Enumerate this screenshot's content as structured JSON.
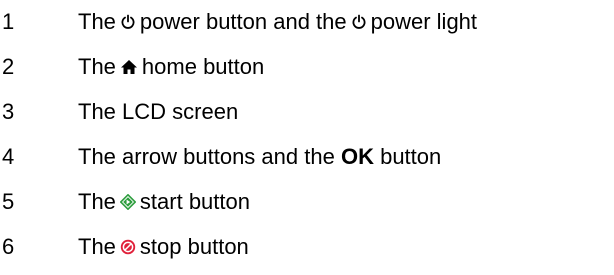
{
  "items": [
    {
      "num": "1",
      "pre": "The",
      "mid": "power button and the",
      "post": "power light",
      "icons": [
        "power-icon",
        "power-icon"
      ]
    },
    {
      "num": "2",
      "pre": "The",
      "post": "home button",
      "icons": [
        "home-icon"
      ]
    },
    {
      "num": "3",
      "text": "The LCD screen"
    },
    {
      "num": "4",
      "pre": "The arrow buttons and the",
      "bold": "OK",
      "post": "button"
    },
    {
      "num": "5",
      "pre": "The",
      "post": "start button",
      "icons": [
        "start-icon"
      ]
    },
    {
      "num": "6",
      "pre": "The",
      "post": "stop button",
      "icons": [
        "stop-icon"
      ]
    }
  ],
  "colors": {
    "text": "#000000",
    "start_icon": "#2e9e3f",
    "stop_icon": "#e0203a"
  }
}
